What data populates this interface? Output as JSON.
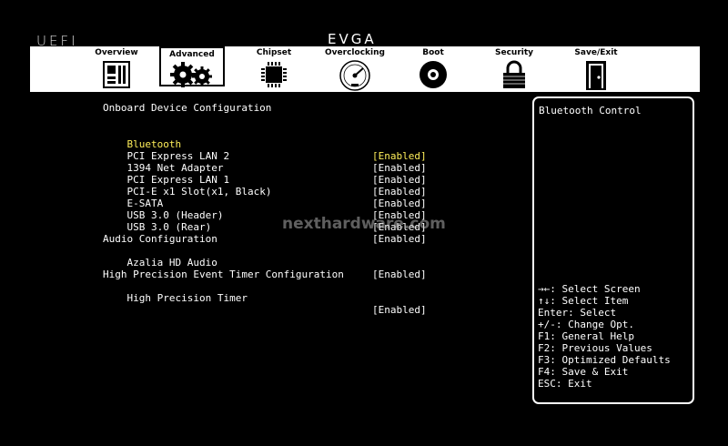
{
  "header": {
    "uefi": "UEFI",
    "brand": "EVGA"
  },
  "tabs": [
    {
      "label": "Overview",
      "icon": "motherboard-icon",
      "active": false
    },
    {
      "label": "Advanced",
      "icon": "gears-icon",
      "active": true
    },
    {
      "label": "Chipset",
      "icon": "chip-icon",
      "active": false
    },
    {
      "label": "Overclocking",
      "icon": "gauge-icon",
      "active": false
    },
    {
      "label": "Boot",
      "icon": "disc-icon",
      "active": false
    },
    {
      "label": "Security",
      "icon": "padlock-icon",
      "active": false
    },
    {
      "label": "Save/Exit",
      "icon": "door-icon",
      "active": false
    }
  ],
  "main": {
    "section_onboard": "Onboard Device Configuration",
    "items": [
      {
        "label": "Bluetooth",
        "value": "[Enabled]"
      },
      {
        "label": "PCI Express LAN 2",
        "value": "[Enabled]"
      },
      {
        "label": "1394 Net Adapter",
        "value": "[Enabled]"
      },
      {
        "label": "PCI Express LAN 1",
        "value": "[Enabled]"
      },
      {
        "label": "PCI-E x1 Slot(x1, Black)",
        "value": "[Enabled]"
      },
      {
        "label": "E-SATA",
        "value": "[Enabled]"
      },
      {
        "label": "USB 3.0 (Header)",
        "value": "[Enabled]"
      },
      {
        "label": "USB 3.0 (Rear)",
        "value": "[Enabled]"
      }
    ],
    "section_audio": "Audio Configuration",
    "audio": {
      "label": "Azalia HD Audio",
      "value": "[Enabled]"
    },
    "section_hpet": "High Precision Event Timer Configuration",
    "hpet": {
      "label": "High Precision Timer",
      "value": "[Enabled]"
    }
  },
  "help": {
    "title": "Bluetooth Control",
    "keys": [
      "→←: Select Screen",
      "↑↓: Select Item",
      "Enter: Select",
      "+/-: Change Opt.",
      "F1: General Help",
      "F2: Previous Values",
      "F3: Optimized Defaults",
      "F4: Save & Exit",
      "ESC: Exit"
    ]
  },
  "watermark": "nexthardware.com",
  "colors": {
    "selected": "#ffef5a",
    "text": "#ffffff",
    "background": "#000000"
  }
}
